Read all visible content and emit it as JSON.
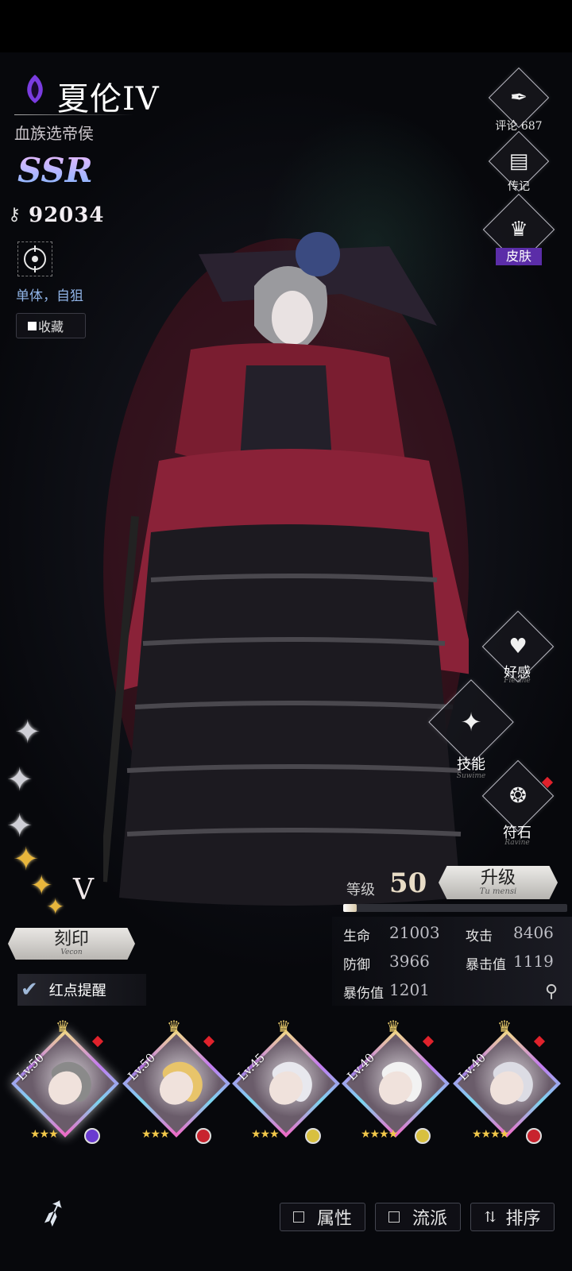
{
  "character": {
    "name": "夏伦IV",
    "title": "血族选帝侯",
    "rarity": "SSR",
    "power": "92034",
    "target_type": "单体，自狙",
    "favorite_label": "收藏",
    "tier": "V"
  },
  "side_menu": {
    "comments_label": "评论 687",
    "biography_label": "传记",
    "skin_label": "皮肤",
    "affinity_label": "好感",
    "affinity_sub": "Fie'ane",
    "skills_label": "技能",
    "skills_sub": "Suwime",
    "rune_label": "符石",
    "rune_sub": "Ravine"
  },
  "engrave": {
    "label": "刻印",
    "sub": "Vecon"
  },
  "red_dot_reminder": {
    "label": "红点提醒",
    "checked": true
  },
  "level": {
    "label": "等级",
    "value": "50",
    "upgrade_label": "升级",
    "upgrade_sub": "Tu mensi",
    "xp_progress": 0.06
  },
  "stats": [
    {
      "label": "生命",
      "value": "21003"
    },
    {
      "label": "攻击",
      "value": "8406"
    },
    {
      "label": "防御",
      "value": "3966"
    },
    {
      "label": "暴击值",
      "value": "1119"
    },
    {
      "label": "暴伤值",
      "value": "1201"
    }
  ],
  "stars": {
    "silver": 3,
    "gold": 3
  },
  "roster": [
    {
      "level": "Lv.50",
      "stars": "★★★",
      "hair": "#8a8a8a",
      "element": "#6a3bd0",
      "selected": true
    },
    {
      "level": "Lv.50",
      "stars": "★★★",
      "hair": "#e8c46a",
      "element": "#c8232e",
      "selected": false
    },
    {
      "level": "Lv.45",
      "stars": "★★★",
      "hair": "#e8e8ee",
      "element": "#d8c040",
      "selected": false
    },
    {
      "level": "Lv.40",
      "stars": "★★★★",
      "hair": "#f2f2f2",
      "element": "#d8c040",
      "selected": false
    },
    {
      "level": "Lv.40",
      "stars": "★★★★",
      "hair": "#dcdce4",
      "element": "#c8232e",
      "selected": false
    }
  ],
  "bottom_bar": {
    "attribute_label": "属性",
    "school_label": "流派",
    "sort_label": "排序"
  },
  "colors": {
    "accent_purple": "#5b2da8",
    "red_dot": "#e0222c",
    "gold_star": "#e8b63c"
  }
}
